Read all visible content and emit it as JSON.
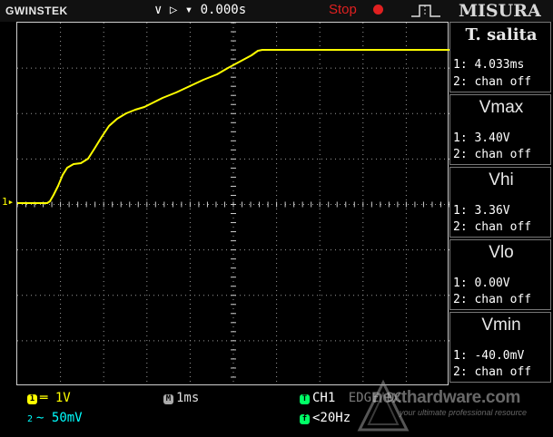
{
  "header": {
    "brand": "GWINSTEK",
    "trigger_delay": "∨ ▷ ▾ 0.000s",
    "run_state": "Stop",
    "menu_title": "MISURA"
  },
  "channel_marker": "1▸",
  "measurements": [
    {
      "name": "T. salita",
      "ch1": "1: 4.033ms",
      "ch2": "2: chan off"
    },
    {
      "name": "Vmax",
      "ch1": "1: 3.40V",
      "ch2": "2: chan off"
    },
    {
      "name": "Vhi",
      "ch1": "1: 3.36V",
      "ch2": "2: chan off"
    },
    {
      "name": "Vlo",
      "ch1": "1: 0.00V",
      "ch2": "2: chan off"
    },
    {
      "name": "Vmin",
      "ch1": "1: -40.0mV",
      "ch2": "2: chan off"
    }
  ],
  "status": {
    "ch1_badge": "1",
    "ch1_scale": "═ 1V",
    "ch2_badge": "2",
    "ch2_scale": "∼ 50mV",
    "timebase_badge": "M",
    "timebase": "1ms",
    "trigger_badge": "T",
    "trigger_source": "CH1",
    "trigger_mode": "EDGE  DC",
    "filter_badge": "f",
    "filter": "<20Hz"
  },
  "watermark": {
    "text": "nexthardware.com",
    "tagline": "your ultimate professional resource"
  },
  "colors": {
    "ch1_trace": "#ffff00",
    "ch2": "#00ffff",
    "trigger": "#00ff66",
    "stop": "#e02020",
    "grid": "#cfcfcf"
  }
}
